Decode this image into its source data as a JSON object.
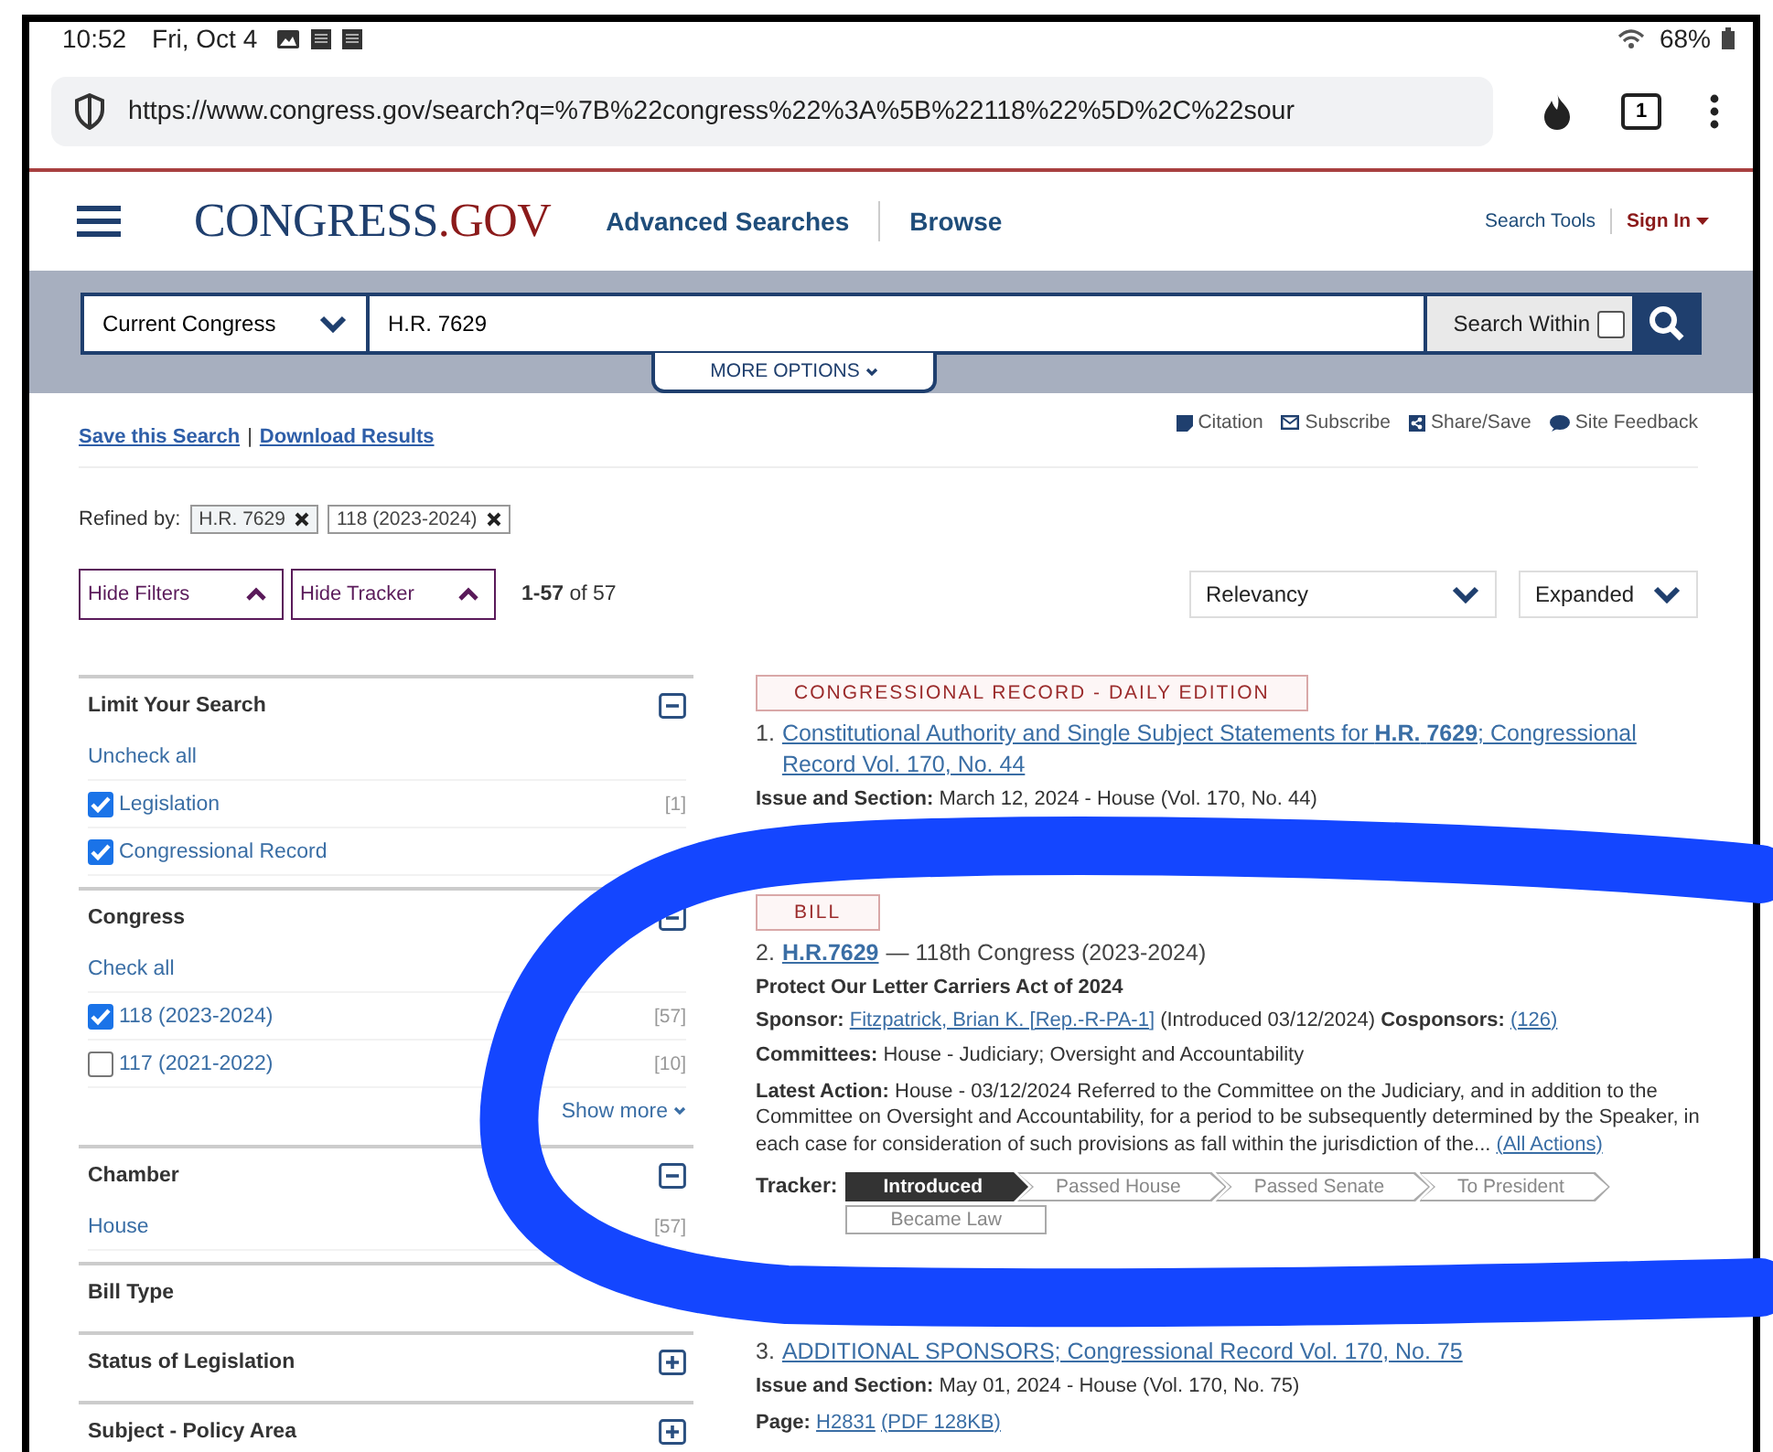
{
  "status_bar": {
    "time": "10:52",
    "date": "Fri, Oct 4",
    "battery": "68%"
  },
  "browser": {
    "url": "https://www.congress.gov/search?q=%7B%22congress%22%3A%5B%22118%22%5D%2C%22sour",
    "tab_count": "1"
  },
  "header": {
    "logo_main": "CONGRESS",
    "logo_tld": ".GOV",
    "nav": [
      "Advanced Searches",
      "Browse"
    ],
    "search_tools": "Search Tools",
    "sign_in": "Sign In"
  },
  "search": {
    "scope": "Current Congress",
    "query": "H.R. 7629",
    "search_within": "Search Within",
    "search_within_checked": false,
    "more_options": "MORE OPTIONS"
  },
  "actions": {
    "save": "Save this Search",
    "separator": "|",
    "download": "Download Results",
    "tools": [
      {
        "kind": "citation",
        "label": "Citation"
      },
      {
        "kind": "subscribe",
        "label": "Subscribe"
      },
      {
        "kind": "share",
        "label": "Share/Save"
      },
      {
        "kind": "feedback",
        "label": "Site Feedback"
      }
    ]
  },
  "refined_by": {
    "label": "Refined by:",
    "chips": [
      "H.R. 7629",
      "118 (2023-2024)"
    ]
  },
  "controls": {
    "toggles": [
      "Hide Filters",
      "Hide Tracker"
    ],
    "count": "**1-57** of 57",
    "sort": "Relevancy",
    "view": "Expanded"
  },
  "filters": [
    {
      "title": "Limit Your Search",
      "expanded": true,
      "action": "Uncheck all",
      "options": [
        {
          "kind": "checkbox",
          "label": "Legislation",
          "checked": true,
          "count": "[1]"
        },
        {
          "kind": "checkbox",
          "label": "Congressional Record",
          "checked": true
        }
      ]
    },
    {
      "title": "Congress",
      "expanded": true,
      "action": "Check all",
      "options": [
        {
          "kind": "checkbox",
          "label": "118 (2023-2024)",
          "checked": true,
          "count": "[57]"
        },
        {
          "kind": "checkbox",
          "label": "117 (2021-2022)",
          "checked": false,
          "count": "[10]"
        }
      ],
      "show_more": "Show more"
    },
    {
      "title": "Chamber",
      "expanded": true,
      "options": [
        {
          "kind": "link",
          "label": "House",
          "count": "[57]"
        }
      ]
    },
    {
      "title": "Bill Type"
    },
    {
      "title": "Status of Legislation",
      "expanded": false
    },
    {
      "title": "Subject - Policy Area",
      "expanded": false
    }
  ],
  "results": [
    {
      "type": "CONGRESSIONAL RECORD - DAILY EDITION",
      "number": "1.",
      "title": "Constitutional Authority and Single Subject Statements for **H.R.** **7629**; Congressional Record Vol. 170, No. 44",
      "lines": [
        [
          {
            "kind": "label",
            "text": "Issue and Section:"
          },
          {
            "kind": "text",
            "text": "March 12, 2024 - House (Vol. 170, No. 44)"
          }
        ]
      ]
    },
    {
      "type": "BILL",
      "number": "2.",
      "title": "**H.R.7629**",
      "title_suffix": "— 118th Congress (2023-2024)",
      "subtitle": "Protect Our Letter Carriers Act of 2024",
      "lines": [
        [
          {
            "kind": "label",
            "text": "Sponsor:"
          },
          {
            "kind": "link",
            "text": "Fitzpatrick, Brian K. [Rep.-R-PA-1]"
          },
          {
            "kind": "text",
            "text": "(Introduced 03/12/2024)"
          },
          {
            "kind": "label",
            "text": "Cosponsors:"
          },
          {
            "kind": "link",
            "text": "(126)"
          }
        ],
        [
          {
            "kind": "label",
            "text": "Committees:"
          },
          {
            "kind": "text",
            "text": "House - Judiciary; Oversight and Accountability"
          }
        ],
        [
          {
            "kind": "label",
            "text": "Latest Action:"
          },
          {
            "kind": "text",
            "text": "House - 03/12/2024 Referred to the Committee on the Judiciary, and in addition to the Committee on Oversight and Accountability, for a period to be subsequently determined by the Speaker, in each case for consideration of such provisions as fall within the jurisdiction of the..."
          },
          {
            "kind": "link",
            "text": "(All Actions)"
          }
        ]
      ],
      "tracker": {
        "label": "Tracker:",
        "steps": [
          {
            "label": "Introduced",
            "selected": true
          },
          {
            "label": "Passed House",
            "selected": false
          },
          {
            "label": "Passed Senate",
            "selected": false
          },
          {
            "label": "To President",
            "selected": false
          },
          {
            "label": "Became Law",
            "selected": false
          }
        ]
      }
    },
    {
      "number": "3.",
      "title": "ADDITIONAL SPONSORS; Congressional Record Vol. 170, No. 75",
      "lines": [
        [
          {
            "kind": "label",
            "text": "Issue and Section:"
          },
          {
            "kind": "text",
            "text": "May 01, 2024 - House (Vol. 170, No. 75)"
          }
        ],
        [
          {
            "kind": "label",
            "text": "Page:"
          },
          {
            "kind": "link",
            "text": "H2831"
          },
          {
            "kind": "link",
            "text": "(PDF 128KB)"
          }
        ]
      ]
    }
  ]
}
